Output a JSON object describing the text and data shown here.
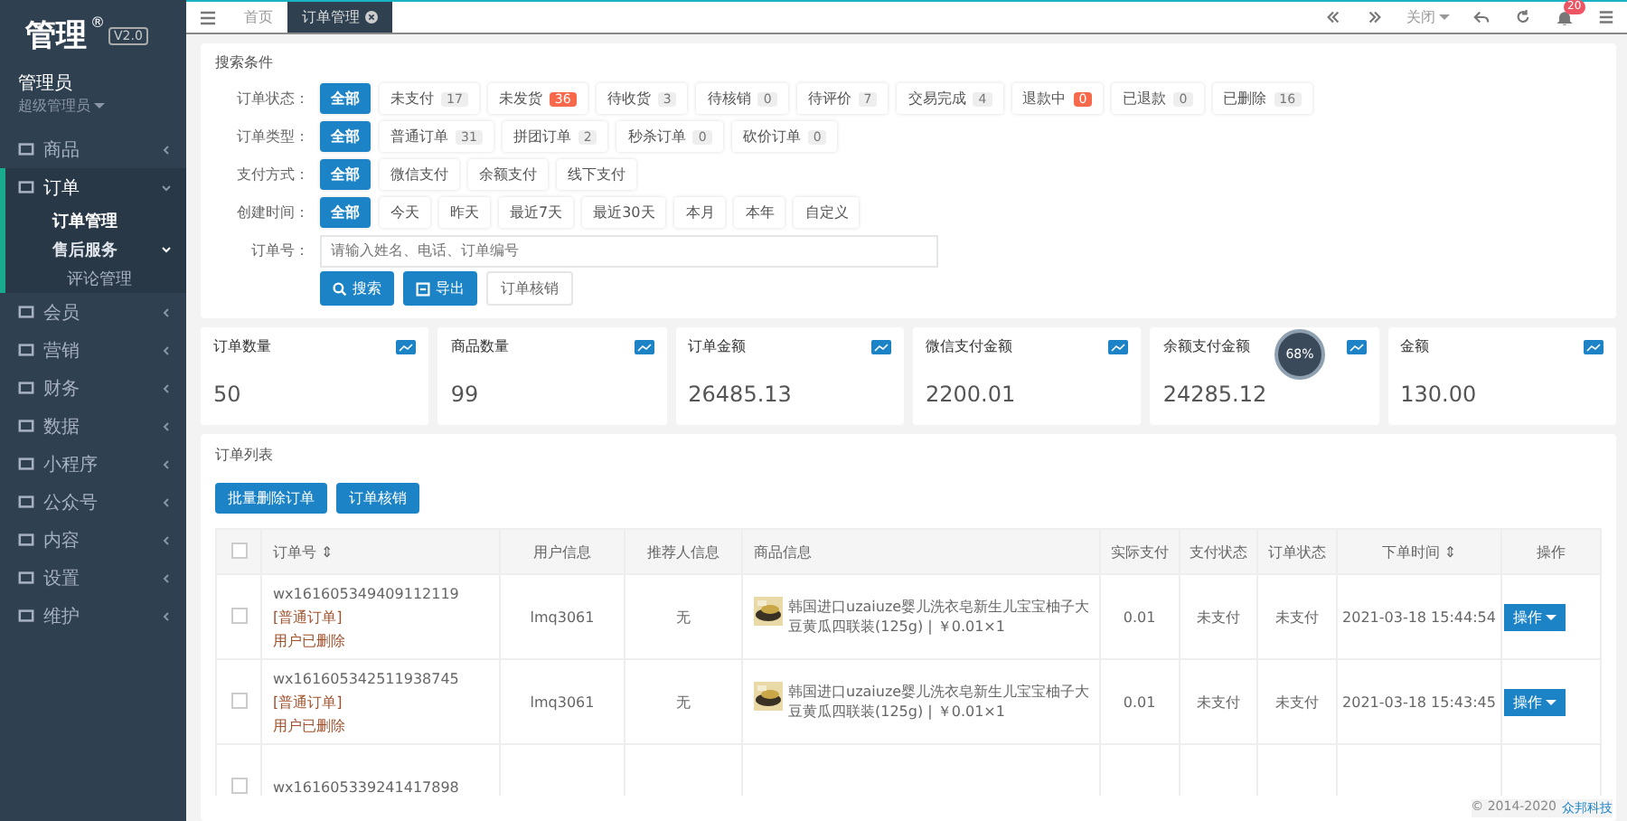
{
  "sidebar": {
    "logo": "管理",
    "logo_mark": "®",
    "version": "V2.0",
    "user": {
      "name": "管理员",
      "role": "超级管理员"
    },
    "menu": [
      {
        "label": "商品",
        "expanded": false
      },
      {
        "label": "订单",
        "expanded": true,
        "children": [
          {
            "label": "订单管理",
            "selected": true
          },
          {
            "label": "售后服务",
            "selected": false,
            "expanded": true,
            "children": [
              {
                "label": "评论管理",
                "selected": false
              }
            ]
          }
        ]
      },
      {
        "label": "会员",
        "expanded": false
      },
      {
        "label": "营销",
        "expanded": false
      },
      {
        "label": "财务",
        "expanded": false
      },
      {
        "label": "数据",
        "expanded": false
      },
      {
        "label": "小程序",
        "expanded": false
      },
      {
        "label": "公众号",
        "expanded": false
      },
      {
        "label": "内容",
        "expanded": false
      },
      {
        "label": "设置",
        "expanded": false
      },
      {
        "label": "维护",
        "expanded": false
      }
    ]
  },
  "topbar": {
    "tabs": [
      {
        "label": "首页",
        "selected": false,
        "closable": false
      },
      {
        "label": "订单管理",
        "selected": true,
        "closable": true
      }
    ],
    "close_menu": "关闭",
    "notifications": "20"
  },
  "search": {
    "title": "搜索条件",
    "filters": [
      {
        "label": "订单状态：",
        "options": [
          {
            "label": "全部",
            "selected": true
          },
          {
            "label": "未支付",
            "count": "17",
            "selected": false,
            "alert": false
          },
          {
            "label": "未发货",
            "count": "36",
            "selected": false,
            "alert": true
          },
          {
            "label": "待收货",
            "count": "3",
            "selected": false,
            "alert": false
          },
          {
            "label": "待核销",
            "count": "0",
            "selected": false,
            "alert": false
          },
          {
            "label": "待评价",
            "count": "7",
            "selected": false,
            "alert": false
          },
          {
            "label": "交易完成",
            "count": "4",
            "selected": false,
            "alert": false
          },
          {
            "label": "退款中",
            "count": "0",
            "selected": false,
            "alert": true
          },
          {
            "label": "已退款",
            "count": "0",
            "selected": false,
            "alert": false
          },
          {
            "label": "已删除",
            "count": "16",
            "selected": false,
            "alert": false
          }
        ]
      },
      {
        "label": "订单类型：",
        "options": [
          {
            "label": "全部",
            "selected": true
          },
          {
            "label": "普通订单",
            "count": "31",
            "selected": false,
            "alert": false
          },
          {
            "label": "拼团订单",
            "count": "2",
            "selected": false,
            "alert": false
          },
          {
            "label": "秒杀订单",
            "count": "0",
            "selected": false,
            "alert": false
          },
          {
            "label": "砍价订单",
            "count": "0",
            "selected": false,
            "alert": false
          }
        ]
      },
      {
        "label": "支付方式：",
        "options": [
          {
            "label": "全部",
            "selected": true
          },
          {
            "label": "微信支付",
            "selected": false
          },
          {
            "label": "余额支付",
            "selected": false
          },
          {
            "label": "线下支付",
            "selected": false
          }
        ]
      },
      {
        "label": "创建时间：",
        "options": [
          {
            "label": "全部",
            "selected": true
          },
          {
            "label": "今天",
            "selected": false
          },
          {
            "label": "昨天",
            "selected": false
          },
          {
            "label": "最近7天",
            "selected": false
          },
          {
            "label": "最近30天",
            "selected": false
          },
          {
            "label": "本月",
            "selected": false
          },
          {
            "label": "本年",
            "selected": false
          },
          {
            "label": "自定义",
            "selected": false
          }
        ]
      }
    ],
    "order_no": {
      "label": "订单号：",
      "placeholder": "请输入姓名、电话、订单编号"
    },
    "buttons": [
      {
        "label": "搜索",
        "kind": "primary"
      },
      {
        "label": "导出",
        "kind": "primary"
      },
      {
        "label": "订单核销",
        "kind": "plain"
      }
    ]
  },
  "stats": [
    {
      "label": "订单数量",
      "value": "50"
    },
    {
      "label": "商品数量",
      "value": "99"
    },
    {
      "label": "订单金额",
      "value": "26485.13"
    },
    {
      "label": "微信支付金额",
      "value": "2200.01"
    },
    {
      "label": "余额支付金额",
      "value": "24285.12"
    },
    {
      "label": "金额",
      "value": "130.00"
    }
  ],
  "speed_ball": {
    "value": "68%"
  },
  "orders": {
    "title": "订单列表",
    "buttons": [
      "批量删除订单",
      "订单核销"
    ],
    "all_checked": false,
    "columns": [
      "订单号 ⇕",
      "用户信息",
      "推荐人信息",
      "商品信息",
      "实际支付",
      "支付状态",
      "订单状态",
      "下单时间 ⇕",
      "操作"
    ],
    "rows": [
      {
        "checked": false,
        "order_no": "wx161605349409112119",
        "type": "[普通订单]",
        "note": "用户已删除",
        "user": "lmq3061",
        "referrer": "无",
        "product": "韩国进口uzaiuze婴儿洗衣皂新生儿宝宝柚子大豆黄瓜四联装(125g) | ￥0.01×1",
        "paid": "0.01",
        "pay_status": "未支付",
        "status": "未支付",
        "time": "2021-03-18 15:44:54",
        "action": "操作"
      },
      {
        "checked": false,
        "order_no": "wx161605342511938745",
        "type": "[普通订单]",
        "note": "用户已删除",
        "user": "lmq3061",
        "referrer": "无",
        "product": "韩国进口uzaiuze婴儿洗衣皂新生儿宝宝柚子大豆黄瓜四联装(125g) | ￥0.01×1",
        "paid": "0.01",
        "pay_status": "未支付",
        "status": "未支付",
        "time": "2021-03-18 15:43:45",
        "action": "操作"
      },
      {
        "checked": false,
        "order_no": "wx161605339241417898"
      }
    ]
  },
  "footer": {
    "copyright": "© 2014-2020",
    "company": "众邦科技"
  }
}
